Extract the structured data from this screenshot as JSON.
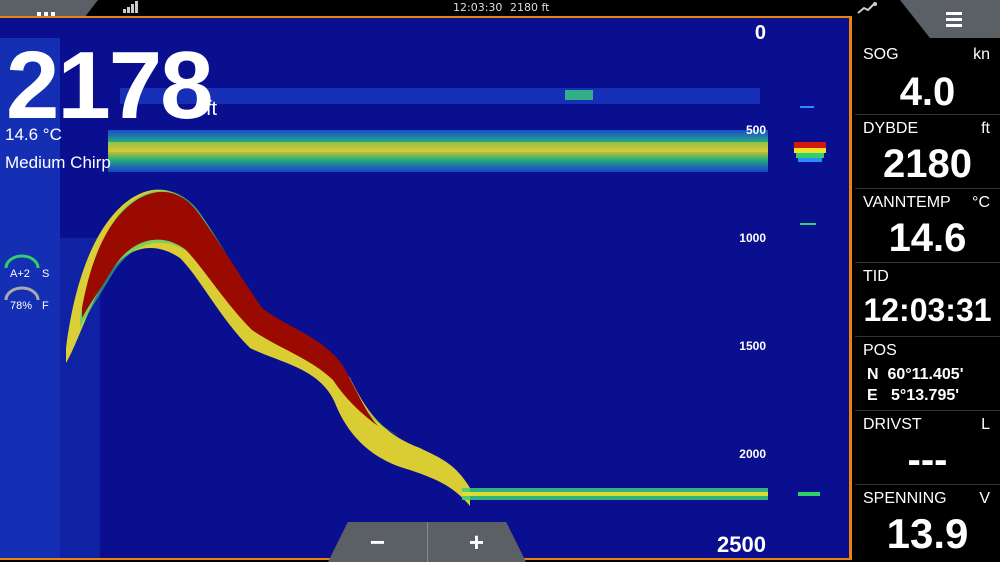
{
  "status": {
    "time": "12:03:30",
    "depth": "2180 ft"
  },
  "sonar": {
    "depth_value": "2178",
    "depth_unit": "ft",
    "water_temp": "14.6 °C",
    "mode": "Medium Chirp",
    "range_top": "0",
    "range_bottom": "2500",
    "scale_labels": [
      "500",
      "1000",
      "1500",
      "2000"
    ],
    "gain_label": "A+2",
    "gain_marker": "S",
    "color_label": "78%",
    "color_marker": "F",
    "zoom_out": "−",
    "zoom_in": "+"
  },
  "panel": {
    "sog_label": "SOG",
    "sog_unit": "kn",
    "sog_value": "4.0",
    "depth_label": "DYBDE",
    "depth_unit": "ft",
    "depth_value": "2180",
    "temp_label": "VANNTEMP",
    "temp_unit": "°C",
    "temp_value": "14.6",
    "time_label": "TID",
    "time_value": "12:03:31",
    "pos_label": "POS",
    "pos_lat": "N  60°11.405'",
    "pos_lon": "E   5°13.795'",
    "fuel_label": "DRIVST",
    "fuel_unit": "L",
    "fuel_value": "---",
    "volt_label": "SPENNING",
    "volt_unit": "V",
    "volt_value": "13.9"
  },
  "colors": {
    "sonar_bg": "#0a0f8f",
    "accent": "#e9830d",
    "target": "#9b0a00"
  }
}
